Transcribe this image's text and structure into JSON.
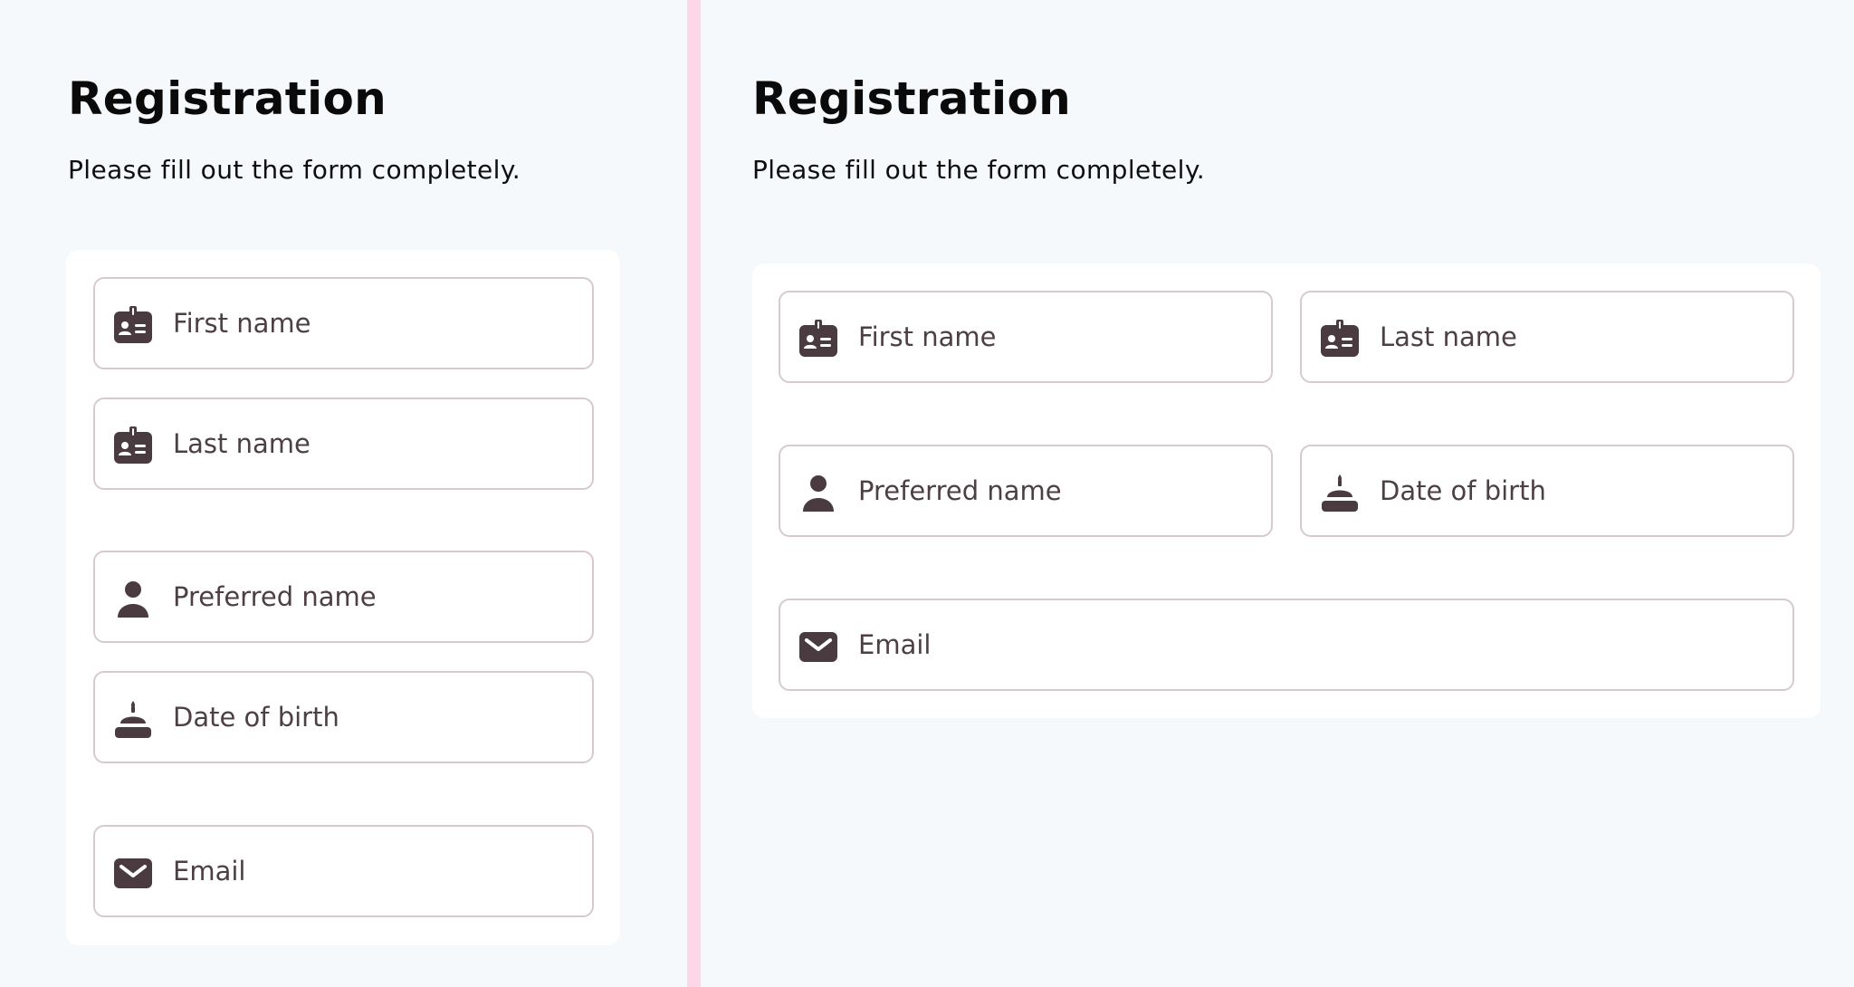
{
  "left": {
    "title": "Registration",
    "subtitle": "Please fill out the form completely.",
    "fields": [
      {
        "placeholder": "First name",
        "icon": "id-badge-icon",
        "value": ""
      },
      {
        "placeholder": "Last name",
        "icon": "id-badge-icon",
        "value": ""
      },
      {
        "placeholder": "Preferred name",
        "icon": "user-icon",
        "value": ""
      },
      {
        "placeholder": "Date of birth",
        "icon": "birthday-cake-icon",
        "value": ""
      },
      {
        "placeholder": "Email",
        "icon": "envelope-icon",
        "value": ""
      }
    ]
  },
  "right": {
    "title": "Registration",
    "subtitle": "Please fill out the form completely.",
    "fields": [
      {
        "placeholder": "First name",
        "icon": "id-badge-icon",
        "value": ""
      },
      {
        "placeholder": "Last name",
        "icon": "id-badge-icon",
        "value": ""
      },
      {
        "placeholder": "Preferred name",
        "icon": "user-icon",
        "value": ""
      },
      {
        "placeholder": "Date of birth",
        "icon": "birthday-cake-icon",
        "value": ""
      },
      {
        "placeholder": "Email",
        "icon": "envelope-icon",
        "value": ""
      }
    ]
  },
  "colors": {
    "background": "#f6f9fb",
    "divider": "#fcd7e8",
    "card": "#ffffff",
    "field_border": "#d8c9ce",
    "icon": "#4a3b40",
    "text": "#0a0a0a"
  }
}
